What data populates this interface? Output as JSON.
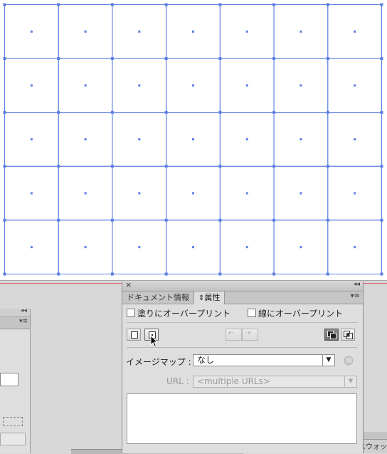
{
  "panel": {
    "tabs": [
      {
        "label": "ドキュメント情報"
      },
      {
        "label": "属性",
        "arrows": "⇕"
      }
    ],
    "overprint_fill_label": "塗りにオーバープリント",
    "overprint_stroke_label": "線にオーバープリント",
    "imagemap_label": "イメージマップ :",
    "imagemap_value": "なし",
    "url_label": "URL :",
    "url_placeholder": "<multiple URLs>",
    "close_glyph": "×",
    "collapse_glyph": "◂◂",
    "menu_glyph": "▾≡"
  },
  "colors": {
    "grid_line": "#5b7ee0",
    "artboard_edge": "#e05a6a",
    "panel_bg": "#dedede"
  },
  "canvas": {
    "grid_columns": 7,
    "grid_rows": 5
  },
  "bottom_right": {
    "label": "スウォッ"
  }
}
